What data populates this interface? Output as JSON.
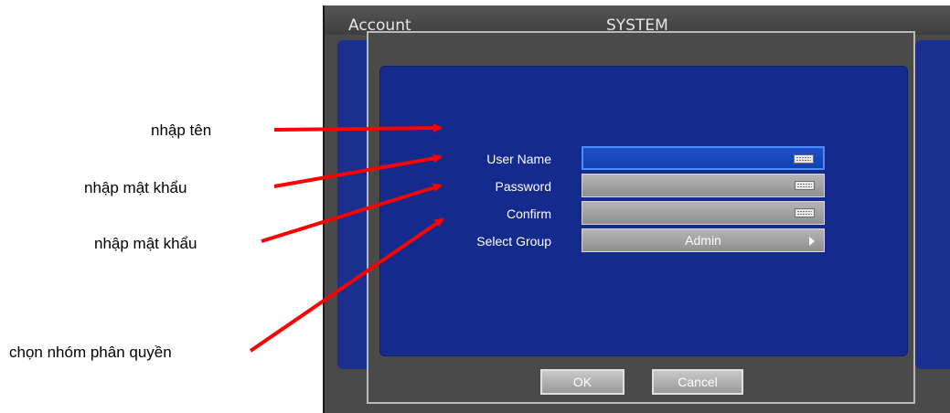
{
  "screen": {
    "header_left": "Account",
    "header_center": "SYSTEM"
  },
  "dialog": {
    "fields": [
      {
        "label": "User Name",
        "icon": "keyboard-icon"
      },
      {
        "label": "Password",
        "icon": "keyboard-icon"
      },
      {
        "label": "Confirm",
        "icon": "keyboard-icon"
      }
    ],
    "select_group": {
      "label": "Select Group",
      "value": "Admin"
    },
    "ok_label": "OK",
    "cancel_label": "Cancel"
  },
  "annotations": {
    "name": "nhập tên",
    "password": "nhập mật khẩu",
    "confirm": "nhập mật khẩu",
    "group": "chọn nhóm phân quyền"
  },
  "colors": {
    "panel_blue": "#142a8c",
    "arrow_red": "#ff0000",
    "active_field": "#1e50c8"
  }
}
